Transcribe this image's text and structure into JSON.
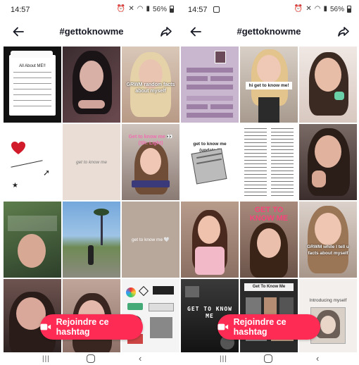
{
  "screens": [
    {
      "status_time": "14:57",
      "battery": "56%",
      "title": "#gettoknowme",
      "join_button": "Rejoindre ce hashtag",
      "tiles": [
        "All About ME!!",
        "",
        "GRWM random facts about myself",
        "",
        "get to know me",
        "Get to know me 👀 (Sh: Light)",
        "",
        "",
        "get to know me 🤍",
        "",
        "",
        ""
      ]
    },
    {
      "status_time": "14:57",
      "battery": "56%",
      "title": "#gettoknowme",
      "join_button": "Rejoindre ce hashtag",
      "tiles": [
        "",
        "hi get to know me!",
        "",
        "get to know me (updated)",
        "",
        "",
        "",
        "GET TO KNOW ME",
        "GRWM while I tell u facts about myself",
        "GET TO KNOW ME",
        "Get To Know Me",
        "Introducing myself"
      ]
    }
  ],
  "icons": {
    "back": "arrow-left-icon",
    "share": "share-arrow-icon",
    "join": "video-camera-icon"
  },
  "colors": {
    "accent": "#fe2c55",
    "text": "#161823"
  }
}
